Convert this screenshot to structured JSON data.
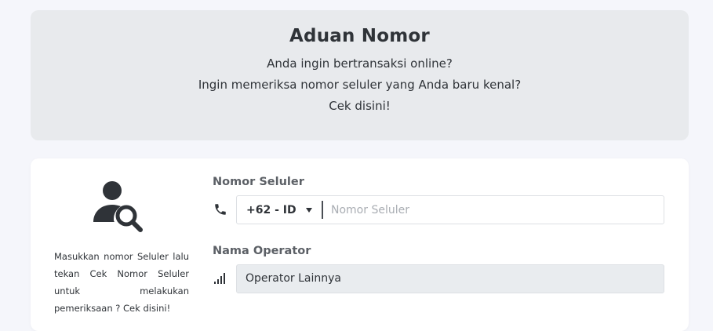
{
  "hero": {
    "title": "Aduan Nomor",
    "line1": "Anda ingin bertransaksi online?",
    "line2": "Ingin memeriksa nomor seluler yang Anda baru kenal?",
    "line3": "Cek disini!"
  },
  "sidebar": {
    "icon": "user-search-icon",
    "helper_text": "Masukkan nomor Seluler lalu tekan Cek Nomor Seluler untuk melakukan pemeriksaan ? Cek disini!"
  },
  "form": {
    "phone": {
      "label": "Nomor Seluler",
      "icon": "phone-icon",
      "country_code": "+62 - ID",
      "placeholder": "Nomor Seluler",
      "value": ""
    },
    "operator": {
      "label": "Nama Operator",
      "icon": "signal-icon",
      "value": "Operator Lainnya"
    }
  },
  "colors": {
    "page_bg": "#f5f6fb",
    "hero_bg": "#e8eaed",
    "card_bg": "#ffffff",
    "text": "#2f3338",
    "label": "#5c6066",
    "disabled_field": "#e9ecef"
  }
}
